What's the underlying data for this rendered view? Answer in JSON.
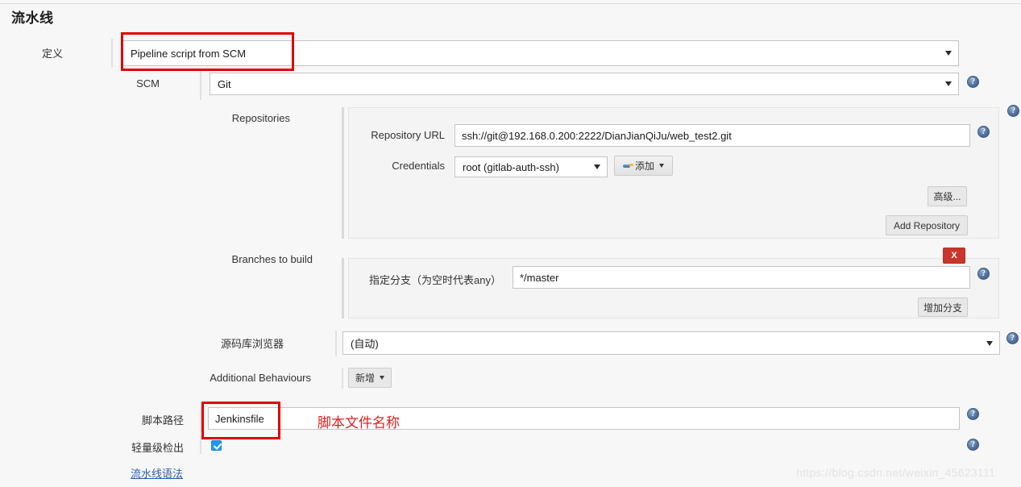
{
  "page": {
    "title": "流水线",
    "watermark": "https://blog.csdn.net/weixin_45623111"
  },
  "definition": {
    "label": "定义",
    "value": "Pipeline script from SCM"
  },
  "scm": {
    "label": "SCM",
    "value": "Git",
    "help_icon": "?"
  },
  "repositories": {
    "label": "Repositories",
    "repository_url": {
      "label": "Repository URL",
      "value": "ssh://git@192.168.0.200:2222/DianJianQiJu/web_test2.git",
      "help_icon": "?"
    },
    "credentials": {
      "label": "Credentials",
      "value": "root (gitlab-auth-ssh)",
      "add_button": "添加",
      "add_button_icon": "key-icon"
    },
    "advanced_button": "高级...",
    "add_repository_button": "Add Repository",
    "help_icon": "?"
  },
  "branches": {
    "label": "Branches to build",
    "branch_specifier": {
      "label": "指定分支（为空时代表any）",
      "value": "*/master",
      "help_icon": "?"
    },
    "delete_button": "X",
    "add_branch_button": "增加分支"
  },
  "repo_browser": {
    "label": "源码库浏览器",
    "value": "(自动)",
    "help_icon": "?"
  },
  "additional_behaviours": {
    "label": "Additional Behaviours",
    "add_button": "新增"
  },
  "script_path": {
    "label": "脚本路径",
    "value": "Jenkinsfile",
    "help_icon": "?"
  },
  "lightweight_checkout": {
    "label": "轻量级检出",
    "checked": true,
    "help_icon": "?"
  },
  "pipeline_syntax_link": "流水线语法",
  "annotations": {
    "script_file_name": "脚本文件名称"
  },
  "colors": {
    "annotation_red": "#e00000",
    "delete_red": "#c9362c",
    "checkbox_blue": "#2196f3",
    "link_blue": "#2b5fa8",
    "help_blue": "#3d5a80"
  }
}
